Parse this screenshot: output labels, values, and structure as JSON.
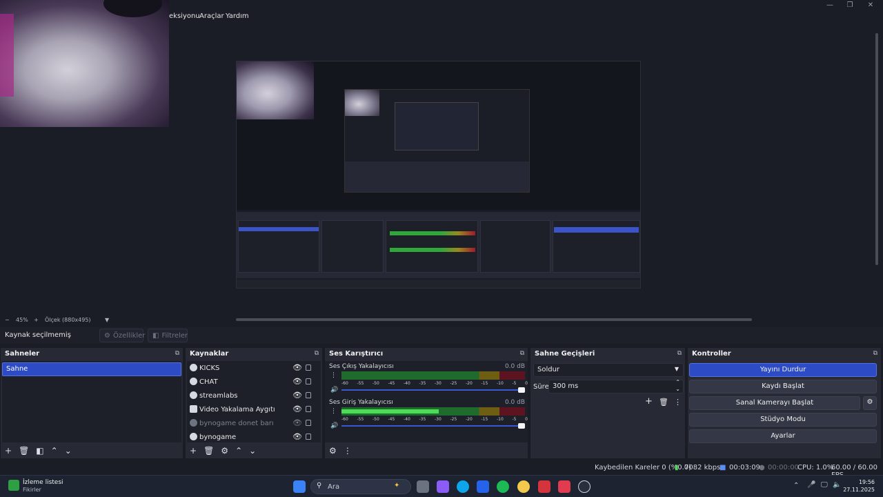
{
  "menu": {
    "items": [
      "eksiyonu",
      "Araçlar",
      "Yardım"
    ]
  },
  "window_controls": {
    "minimize": "—",
    "restore": "❐",
    "close": "✕"
  },
  "zoom": {
    "minus": "−",
    "percent": "45%",
    "plus": "+",
    "scale": "Ölçek (880x495)"
  },
  "context_bar": {
    "no_source": "Kaynak seçilmemiş",
    "properties": "Özellikler",
    "filters": "Filtreler"
  },
  "scenes": {
    "title": "Sahneler",
    "items": [
      "Sahne"
    ]
  },
  "sources": {
    "title": "Kaynaklar",
    "items": [
      {
        "label": "KICKS",
        "dim": false
      },
      {
        "label": "CHAT",
        "dim": false
      },
      {
        "label": "streamlabs",
        "dim": false
      },
      {
        "label": "Video Yakalama Aygıtı",
        "dim": false
      },
      {
        "label": "bynogame donet barı",
        "dim": true
      },
      {
        "label": "bynogame",
        "dim": false
      }
    ]
  },
  "mixer": {
    "title": "Ses Karıştırıcı",
    "channels": [
      {
        "name": "Ses Çıkış Yakalayıcısı",
        "db": "0.0 dB",
        "level": 0
      },
      {
        "name": "Ses Giriş Yakalayıcısı",
        "db": "0.0 dB",
        "level": 0.53
      }
    ],
    "ticks": [
      "-60",
      "-55",
      "-50",
      "-45",
      "-40",
      "-35",
      "-30",
      "-25",
      "-20",
      "-15",
      "-10",
      "-5",
      "0"
    ]
  },
  "transitions": {
    "title": "Sahne Geçişleri",
    "selected": "Soldur",
    "duration_label": "Süre",
    "duration_value": "300 ms"
  },
  "controls": {
    "title": "Kontroller",
    "buttons": [
      "Yayını Durdur",
      "Kaydı Başlat",
      "Sanal Kamerayı Başlat",
      "Stüdyo Modu",
      "Ayarlar"
    ]
  },
  "status": {
    "dropped": "Kaybedilen Kareler 0 (%0.0)",
    "bitrate": "7082 kbps",
    "stream_time": "00:03:09",
    "rec_time": "00:00:00",
    "cpu": "CPU: 1.0%",
    "fps": "60.00 / 60.00 FPS"
  },
  "taskbar": {
    "widget_title": "İzleme listesi",
    "widget_sub": "Fikirler",
    "search": "Ara",
    "time": "19:56",
    "date": "27.11.2025",
    "colors": {
      "start": "#3b82f6",
      "accent": "#2c4bc4"
    }
  }
}
